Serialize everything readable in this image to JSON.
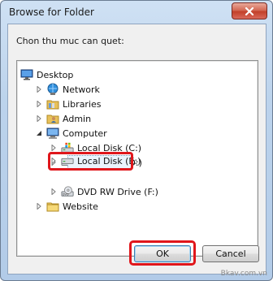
{
  "window": {
    "title": "Browse for Folder"
  },
  "dialog": {
    "prompt": "Chon thu muc can quet:",
    "ok_label": "OK",
    "cancel_label": "Cancel"
  },
  "tree": [
    {
      "label": "Desktop"
    },
    {
      "label": "Network"
    },
    {
      "label": "Libraries"
    },
    {
      "label": "Admin"
    },
    {
      "label": "Computer"
    },
    {
      "label": "Local Disk (C:)"
    },
    {
      "label": "Local Disk (D:)"
    },
    {
      "label": "Local Disk (E:)"
    },
    {
      "label": "DVD RW Drive (F:)"
    },
    {
      "label": "Website"
    }
  ],
  "watermark": "Bkav.com.vn",
  "colors": {
    "highlight": "#e0161b",
    "close_button": "#c2402a",
    "titlebar": "#bcd3ec"
  }
}
